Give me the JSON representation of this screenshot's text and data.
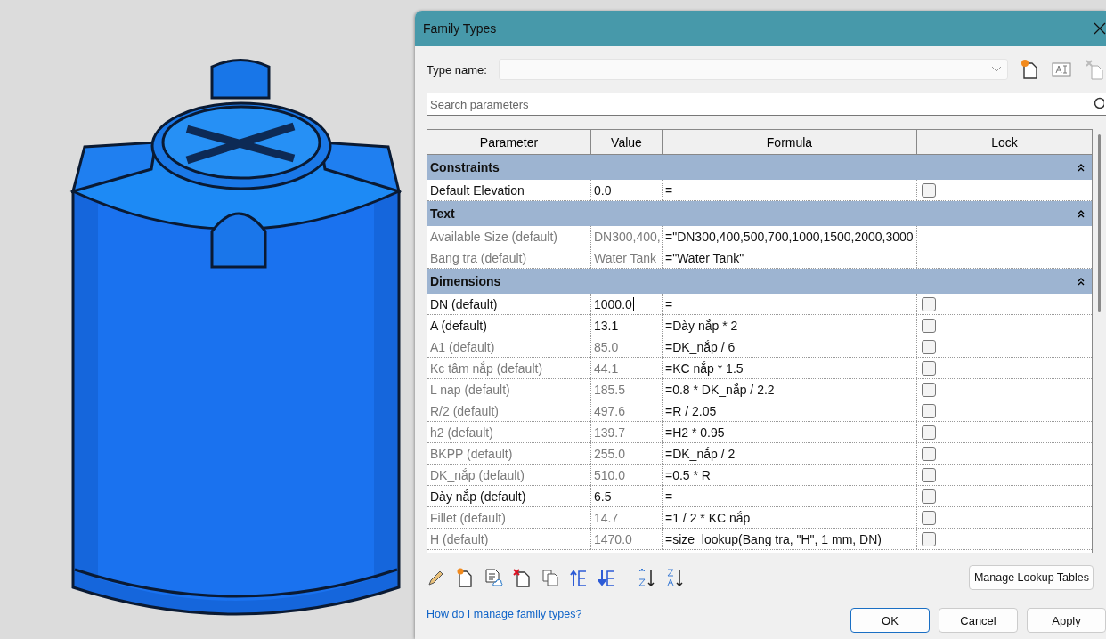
{
  "window": {
    "title": "Family Types"
  },
  "type_name": {
    "label": "Type name:"
  },
  "search": {
    "placeholder": "Search parameters"
  },
  "table": {
    "columns": [
      "Parameter",
      "Value",
      "Formula",
      "Lock"
    ],
    "groups": [
      {
        "name": "Constraints",
        "expanded": true,
        "rows": [
          {
            "parameter": "Default Elevation",
            "value": "0.0",
            "formula": "=",
            "read_only": false,
            "editing": false,
            "lock": false
          }
        ]
      },
      {
        "name": "Text",
        "expanded": true,
        "rows": [
          {
            "parameter": "Available Size (default)",
            "value": "DN300,400,",
            "formula": "=\"DN300,400,500,700,1000,1500,2000,3000",
            "read_only": true,
            "editing": false
          },
          {
            "parameter": "Bang tra (default)",
            "value": "Water Tank",
            "formula": "=\"Water Tank\"",
            "read_only": true,
            "editing": false
          }
        ]
      },
      {
        "name": "Dimensions",
        "expanded": true,
        "rows": [
          {
            "parameter": "DN (default)",
            "value": "1000.0",
            "formula": "=",
            "read_only": false,
            "editing": true,
            "lock": false
          },
          {
            "parameter": "A (default)",
            "value": "13.1",
            "formula": "=Dày nắp * 2",
            "read_only": false,
            "editing": false,
            "lock": false
          },
          {
            "parameter": "A1 (default)",
            "value": "85.0",
            "formula": "=DK_nắp / 6",
            "read_only": true,
            "editing": false,
            "lock": false
          },
          {
            "parameter": "Kc tâm nắp (default)",
            "value": "44.1",
            "formula": "=KC nắp * 1.5",
            "read_only": true,
            "editing": false,
            "lock": false
          },
          {
            "parameter": "L nap (default)",
            "value": "185.5",
            "formula": "=0.8 * DK_nắp / 2.2",
            "read_only": true,
            "editing": false,
            "lock": false
          },
          {
            "parameter": "R/2 (default)",
            "value": "497.6",
            "formula": "=R / 2.05",
            "read_only": true,
            "editing": false,
            "lock": false
          },
          {
            "parameter": "h2 (default)",
            "value": "139.7",
            "formula": "=H2 * 0.95",
            "read_only": true,
            "editing": false,
            "lock": false
          },
          {
            "parameter": "BKPP (default)",
            "value": "255.0",
            "formula": "=DK_nắp / 2",
            "read_only": true,
            "editing": false,
            "lock": false
          },
          {
            "parameter": "DK_nắp (default)",
            "value": "510.0",
            "formula": "=0.5 * R",
            "read_only": true,
            "editing": false,
            "lock": false
          },
          {
            "parameter": "Dày nắp (default)",
            "value": "6.5",
            "formula": "=",
            "read_only": false,
            "editing": false,
            "lock": false
          },
          {
            "parameter": "Fillet (default)",
            "value": "14.7",
            "formula": "=1 / 2 * KC nắp",
            "read_only": true,
            "editing": false,
            "lock": false
          },
          {
            "parameter": "H (default)",
            "value": "1470.0",
            "formula": "=size_lookup(Bang tra, \"H\", 1 mm, DN)",
            "read_only": true,
            "editing": false,
            "lock": false
          }
        ]
      }
    ]
  },
  "manage_button": "Manage Lookup Tables",
  "help_link": "How do I manage family types?",
  "buttons": [
    {
      "label": "OK",
      "default": true
    },
    {
      "label": "Cancel",
      "default": false
    },
    {
      "label": "Apply",
      "default": false
    }
  ]
}
